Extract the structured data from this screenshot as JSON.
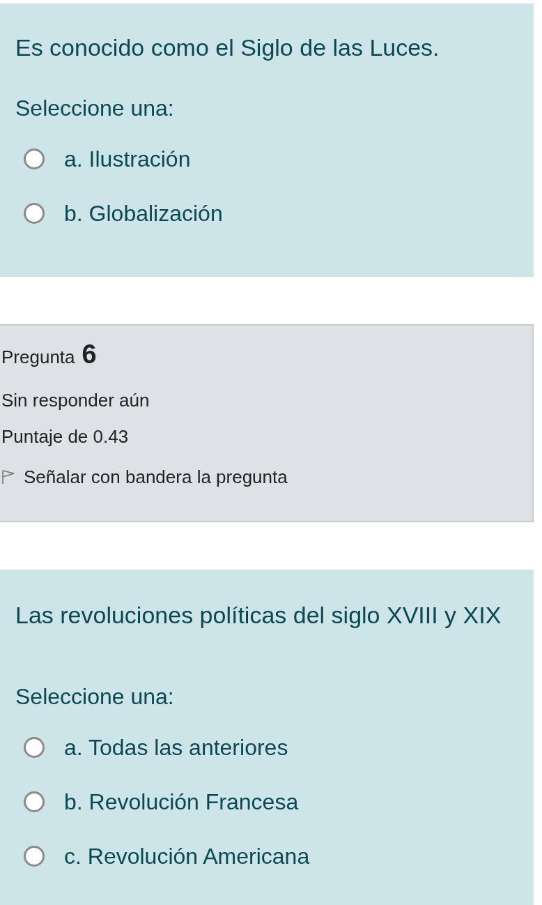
{
  "questions_before": [
    {
      "text": "Es conocido como el Siglo de las Luces.",
      "prompt": "Seleccione una:",
      "options": [
        {
          "label": "a. Ilustración",
          "selected": false
        },
        {
          "label": "b. Globalización",
          "selected": false
        }
      ]
    }
  ],
  "info": {
    "label": "Pregunta",
    "number": "6",
    "status": "Sin responder aún",
    "score": "Puntaje de 0.43",
    "flag": {
      "label": "Señalar con bandera la pregunta",
      "checked": false
    }
  },
  "questions_after": [
    {
      "text": "Las revoluciones políticas del siglo XVIII y XIX",
      "prompt": "Seleccione una:",
      "options": [
        {
          "label": "a. Todas las anteriores",
          "selected": false
        },
        {
          "label": "b. Revolución Francesa",
          "selected": false
        },
        {
          "label": "c. Revolución Americana",
          "selected": false
        }
      ]
    }
  ]
}
